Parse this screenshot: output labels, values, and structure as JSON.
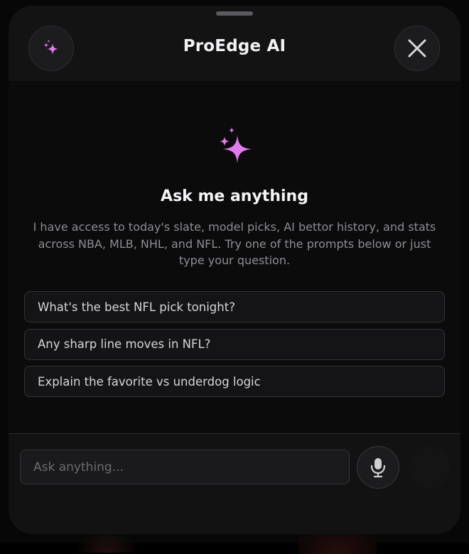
{
  "header": {
    "title": "ProEdge AI"
  },
  "empty_state": {
    "headline": "Ask me anything",
    "description": "I have access to today's slate, model picks, AI bettor history, and stats across NBA, MLB, NHL, and NFL. Try one of the prompts below or just type your question."
  },
  "suggested_prompts": [
    {
      "label": "What's the best NFL pick tonight?"
    },
    {
      "label": "Any sharp line moves in NFL?"
    },
    {
      "label": "Explain the favorite vs underdog logic"
    }
  ],
  "composer": {
    "placeholder": "Ask anything...",
    "value": ""
  },
  "icons": {
    "header_left": "sparkles-icon",
    "header_right": "close-icon",
    "hero": "sparkles-icon",
    "mic": "microphone-icon",
    "send": "send-icon"
  },
  "colors": {
    "accent": "#e37bef",
    "background": "#0b0b0c",
    "text_primary": "#f4f4f6",
    "text_secondary": "#8e8e93"
  }
}
